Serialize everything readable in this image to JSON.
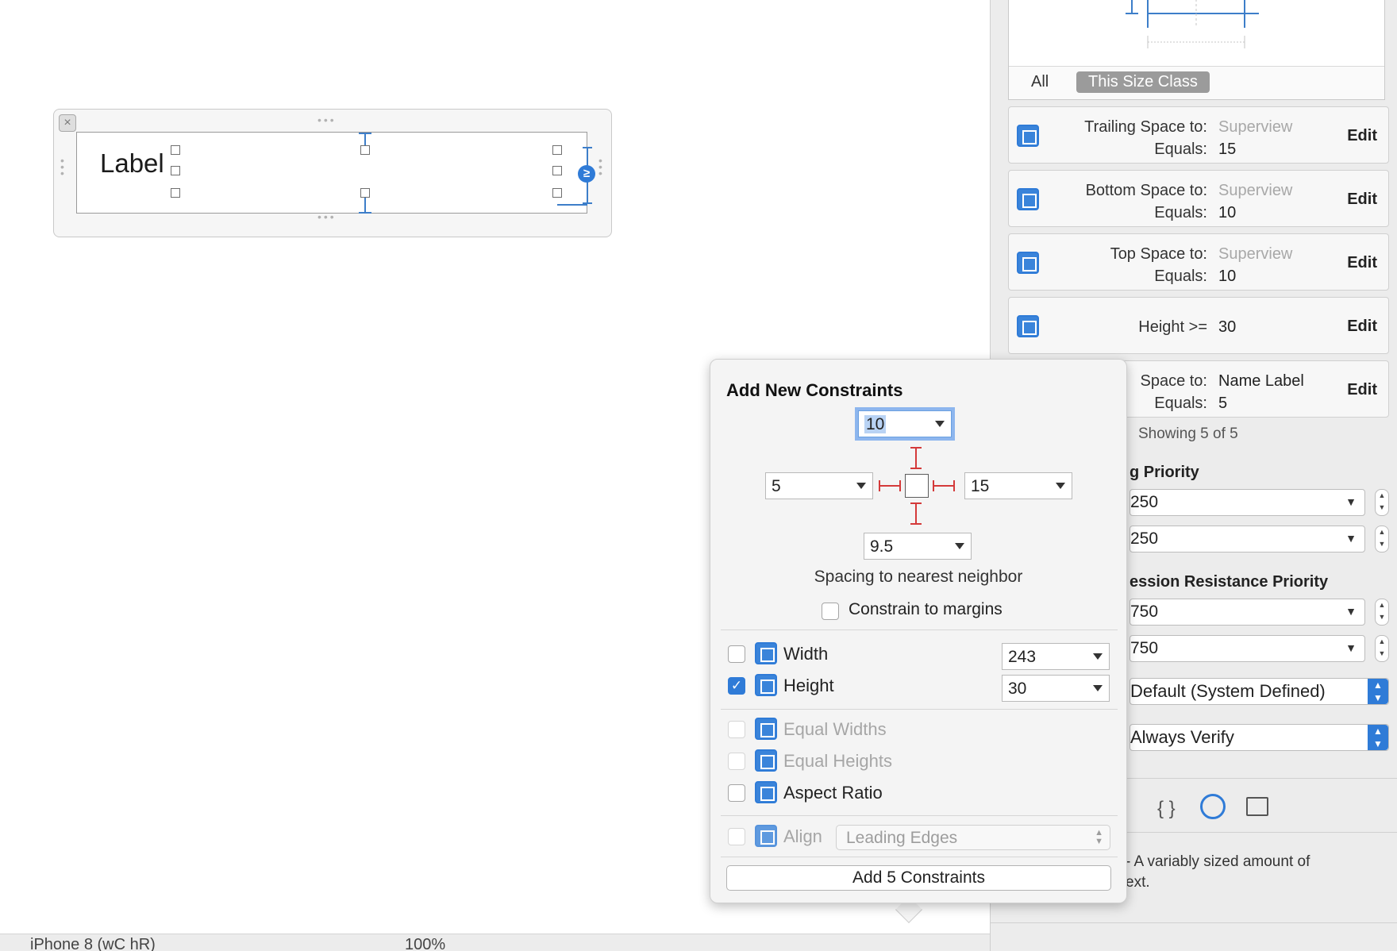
{
  "canvas": {
    "cell_label": "Label",
    "close_icon": "close-icon",
    "constraint_badge": "≥"
  },
  "statusbar": {
    "device": "iPhone 8 (wC hR)",
    "zoom": "100%"
  },
  "inspector": {
    "tabs": {
      "all": "All",
      "size_class": "This Size Class"
    },
    "constraints": [
      {
        "key1": "Trailing Space to:",
        "value1": "Superview",
        "key2": "Equals:",
        "value2": "15",
        "edit": "Edit",
        "icon": "trailing-space-icon"
      },
      {
        "key1": "Bottom Space to:",
        "value1": "Superview",
        "key2": "Equals:",
        "value2": "10",
        "edit": "Edit",
        "icon": "bottom-space-icon"
      },
      {
        "key1": "Top Space to:",
        "value1": "Superview",
        "key2": "Equals:",
        "value2": "10",
        "edit": "Edit",
        "icon": "top-space-icon"
      },
      {
        "key": "Height >=",
        "value": "30",
        "edit": "Edit",
        "icon": "height-icon"
      },
      {
        "key1": "Space to:",
        "value1": "Name Label",
        "key2": "Equals:",
        "value2": "5",
        "edit": "Edit"
      }
    ],
    "showing": "Showing 5 of 5",
    "hugging_heading": "g Priority",
    "hugging_h": "250",
    "hugging_v": "250",
    "compression_heading": "ession Resistance Priority",
    "compression_h": "750",
    "compression_v": "750",
    "intrinsic_size": "Default (System Defined)",
    "ambiguity": "Always Verify",
    "description": "- A variably sized amount of",
    "description2": "ext."
  },
  "popover": {
    "title": "Add New Constraints",
    "top": "10",
    "left": "5",
    "right": "15",
    "bottom": "9.5",
    "spacing_caption": "Spacing to nearest neighbor",
    "constrain_margins": "Constrain to margins",
    "width_label": "Width",
    "width_value": "243",
    "height_label": "Height",
    "height_value": "30",
    "equal_widths": "Equal Widths",
    "equal_heights": "Equal Heights",
    "aspect_ratio": "Aspect Ratio",
    "align_label": "Align",
    "align_value": "Leading Edges",
    "add_button": "Add 5 Constraints",
    "accent": "#2f7bd7",
    "constraint_color": "#d43a3a"
  }
}
